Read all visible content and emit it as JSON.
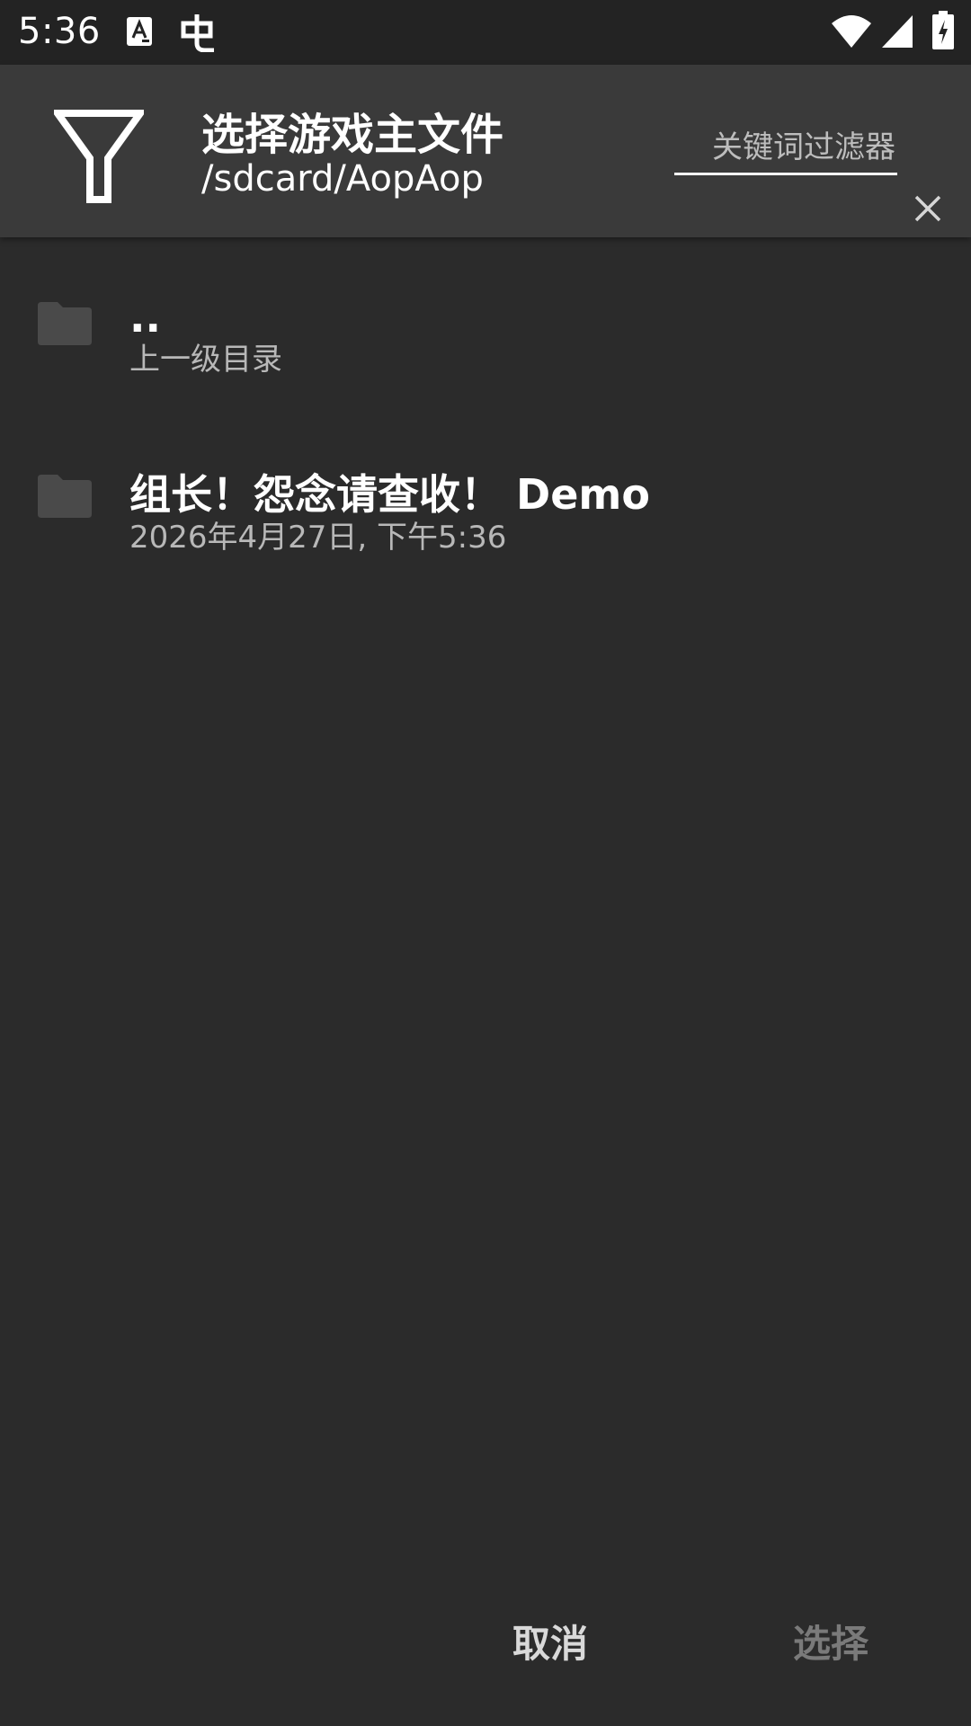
{
  "status_bar": {
    "time": "5:36",
    "icons": [
      "a-notification-icon",
      "bug-notification-icon",
      "wifi-icon",
      "signal-icon",
      "battery-charging-icon"
    ]
  },
  "header": {
    "title": "选择游戏主文件",
    "path": "/sdcard/AopAop",
    "filter_placeholder": "关键词过滤器",
    "filter_value": "",
    "icon": "filter-icon",
    "clear_icon": "close-icon"
  },
  "list": {
    "items": [
      {
        "title": "..",
        "subtitle": "上一级目录",
        "icon": "folder-icon"
      },
      {
        "title": "组长！怨念请查收！ Demo",
        "subtitle": "2026年4月27日, 下午5:36",
        "icon": "folder-icon"
      }
    ]
  },
  "actions": {
    "cancel_label": "取消",
    "select_label": "选择"
  },
  "colors": {
    "background": "#2b2b2b",
    "header": "#3a3a3a",
    "status_bar": "#232323",
    "folder_icon": "#4a4a4a",
    "subtitle": "#b8b8b8",
    "disabled_button": "#7a7a7a"
  }
}
